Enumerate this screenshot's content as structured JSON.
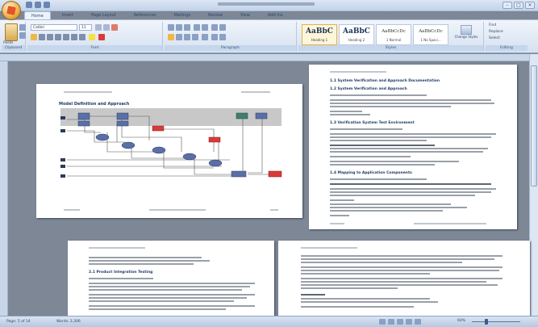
{
  "window": {
    "title": ""
  },
  "ribbon": {
    "tabs": [
      "Home",
      "Insert",
      "Page Layout",
      "References",
      "Mailings",
      "Review",
      "View",
      "Add-Ins"
    ],
    "active_tab": "Home",
    "groups": {
      "clipboard": "Clipboard",
      "font": "Font",
      "paragraph": "Paragraph",
      "styles": "Styles",
      "editing": "Editing"
    },
    "paste_label": "Paste",
    "font_name": "Calibri",
    "font_size": "11",
    "styles": [
      {
        "sample": "AaBbC",
        "name": "Heading 1"
      },
      {
        "sample": "AaBbC",
        "name": "Heading 2"
      },
      {
        "sample": "AaBbCcDc",
        "name": "1 Normal"
      },
      {
        "sample": "AaBbCcDc",
        "name": "1 No Spaci..."
      }
    ],
    "change_styles": "Change Styles",
    "editing_items": [
      "Find",
      "Replace",
      "Select"
    ]
  },
  "document": {
    "page1": {
      "diagram_title": "Model Definition and Approach"
    },
    "page2": {
      "headings": [
        "1.1 System Verification and Approach Documentation",
        "1.2 System Verification and Approach",
        "1.3 Verification System Test Environment",
        "1.4 Mapping to Application Components"
      ]
    },
    "page3": {
      "headings": [
        "2.1 Product Integration Testing"
      ]
    }
  },
  "statusbar": {
    "page": "Page: 5 of 14",
    "words": "Words: 2,306",
    "zoom": "60%",
    "zoom_level": 0.6
  },
  "colors": {
    "accent": "#1f3b67",
    "node_blue": "#5a6fa8",
    "node_red": "#d93a3a",
    "node_teal": "#3f7f6e"
  }
}
